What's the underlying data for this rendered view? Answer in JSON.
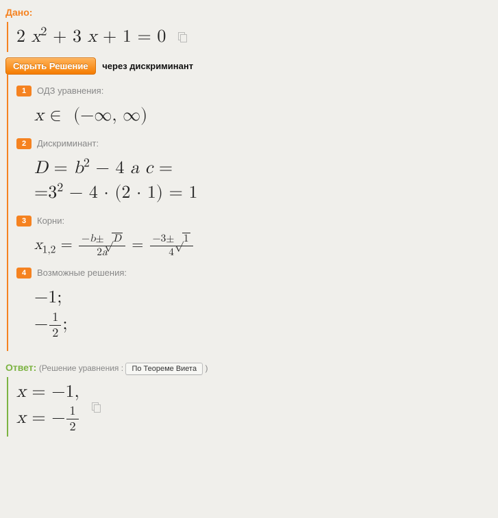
{
  "given": {
    "label": "Дано:",
    "equation_html": "2 <i>x</i><sup>2</sup> + 3 <i>x</i> + 1 = 0"
  },
  "hide_button": "Скрыть Решение",
  "method": "через дискриминант",
  "steps": [
    {
      "num": "1",
      "title": "ОДЗ уравнения:",
      "math_html": "<i>x</i> ∈&nbsp; (−∞, ∞)"
    },
    {
      "num": "2",
      "title": "Дискриминант:",
      "math_html": "<i>D</i> = <i>b</i><sup>2</sup> − 4 <i>a</i> <i>c</i> =<br>=3<sup>2</sup> − 4 · (2 · 1) = 1"
    },
    {
      "num": "3",
      "title": "Корни:",
      "math_html": "<i>x</i><sub>1,2</sub> = <span class=\"frac\"><span class=\"num\">−<i>b</i>±<span class=\"sqrt\"><span class=\"surd\">√</span><span class=\"radicand\"><i>D</i></span></span></span><span class=\"den\">2<i>a</i></span></span> = <span class=\"frac\"><span class=\"num\">−3±<span class=\"sqrt\"><span class=\"surd\">√</span><span class=\"radicand\">1</span></span></span><span class=\"den\">4</span></span>"
    },
    {
      "num": "4",
      "title": "Возможные решения:",
      "math_html": "−1;<br>−<span class=\"frac\"><span class=\"num\">1</span><span class=\"den\">2</span></span>;"
    }
  ],
  "answer": {
    "label": "Ответ:",
    "note_prefix": "(Решение уравнения :",
    "vieta_button": "По Теореме Виета",
    "note_suffix": ")",
    "math_html": "<i>x</i> = −1,<br><i>x</i> = −<span class=\"frac\"><span class=\"num\">1</span><span class=\"den\">2</span></span>"
  }
}
